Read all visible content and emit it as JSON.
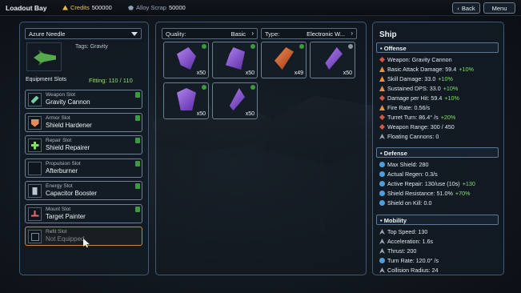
{
  "topbar": {
    "title": "Loadout Bay",
    "credits_label": "Credits",
    "credits_value": "500000",
    "scrap_label": "Alloy Scrap",
    "scrap_value": "50000",
    "back_label": "Back",
    "back_icon": "chevron-left-icon",
    "menu_label": "Menu"
  },
  "loadout": {
    "ship_name": "Azure Needle",
    "tags": "Tags: Gravity",
    "slots_label": "Equipment Slots",
    "fitting": "Fitting: 110 / 110",
    "slots": [
      {
        "type": "Weapon Slot",
        "name": "Gravity Cannon",
        "icon": "cannon-icon",
        "equipped": true
      },
      {
        "type": "Armor Slot",
        "name": "Shield Hardener",
        "icon": "armor-icon",
        "equipped": true
      },
      {
        "type": "Repair Slot",
        "name": "Shield Repairer",
        "icon": "repair-icon",
        "equipped": true
      },
      {
        "type": "Propulsion Slot",
        "name": "Afterburner",
        "icon": "thruster-icon",
        "equipped": true
      },
      {
        "type": "Energy Slot",
        "name": "Capacitor Booster",
        "icon": "energy-icon",
        "equipped": true
      },
      {
        "type": "Mount Slot",
        "name": "Target Painter",
        "icon": "mount-icon",
        "equipped": true
      },
      {
        "type": "Refit Slot",
        "name": "Not Equipped",
        "icon": "refit-icon",
        "equipped": false
      }
    ]
  },
  "inventory": {
    "quality_label": "Quality:",
    "quality_value": "Basic",
    "type_label": "Type:",
    "type_value": "Electronic W...",
    "items": [
      {
        "count": "x50",
        "color": "purple",
        "badge": "green"
      },
      {
        "count": "x50",
        "color": "purple",
        "badge": "green"
      },
      {
        "count": "x49",
        "color": "orange",
        "badge": "green"
      },
      {
        "count": "x50",
        "color": "purple",
        "badge": "grey"
      },
      {
        "count": "x50",
        "color": "purple",
        "badge": "green"
      },
      {
        "count": "x50",
        "color": "purple",
        "badge": "green"
      }
    ]
  },
  "ship_stats": {
    "title": "Ship",
    "offense": {
      "header": "Offense",
      "rows": [
        {
          "text": "Weapon: Gravity Cannon",
          "bonus": ""
        },
        {
          "text": "Basic Attack Damage: 59.4",
          "bonus": "+10%"
        },
        {
          "text": "Skill Damage: 33.0",
          "bonus": "+10%"
        },
        {
          "text": "Sustained DPS: 33.0",
          "bonus": "+10%"
        },
        {
          "text": "Damage per Hit: 59.4",
          "bonus": "+10%"
        },
        {
          "text": "Fire Rate: 0.56/s",
          "bonus": ""
        },
        {
          "text": "Turret Turn: 86.4° /s",
          "bonus": "+20%"
        },
        {
          "text": "Weapon Range: 300 / 450",
          "bonus": ""
        },
        {
          "text": "Floating Cannons: 0",
          "bonus": ""
        }
      ]
    },
    "defense": {
      "header": "Defense",
      "rows": [
        {
          "text": "Max Shield: 280",
          "bonus": ""
        },
        {
          "text": "Actual Regen: 0.3/s",
          "bonus": ""
        },
        {
          "text": "Active Repair: 130/use (10s)",
          "bonus": "+130"
        },
        {
          "text": "Shield Resistance: 51.0%",
          "bonus": "+70%"
        },
        {
          "text": "Shield on Kill: 0.0",
          "bonus": ""
        }
      ]
    },
    "mobility": {
      "header": "Mobility",
      "rows": [
        {
          "text": "Top Speed: 130",
          "bonus": ""
        },
        {
          "text": "Acceleration: 1.6s",
          "bonus": ""
        },
        {
          "text": "Thrust: 200",
          "bonus": ""
        },
        {
          "text": "Turn Rate: 120.0° /s",
          "bonus": ""
        },
        {
          "text": "Collision Radius: 24",
          "bonus": ""
        }
      ]
    }
  }
}
